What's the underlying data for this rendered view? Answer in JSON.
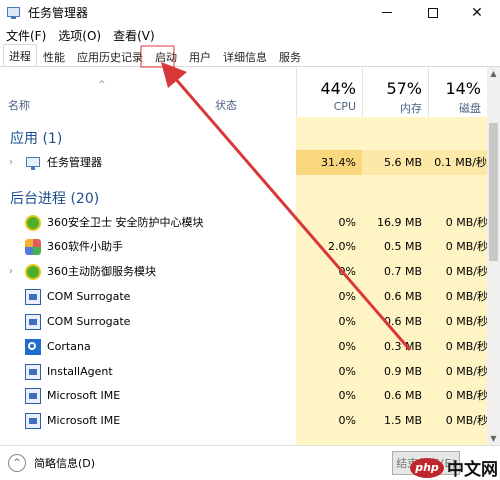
{
  "window": {
    "title": "任务管理器",
    "icon": "task-manager-icon",
    "controls": {
      "minimize": "minimize-icon",
      "maximize": "maximize-icon",
      "close": "close-icon",
      "close_glyph": "✕"
    }
  },
  "menu": {
    "items": [
      "文件(F)",
      "选项(O)",
      "查看(V)"
    ]
  },
  "tabs": [
    {
      "label": "进程",
      "active": true
    },
    {
      "label": "性能",
      "active": false
    },
    {
      "label": "应用历史记录",
      "active": false
    },
    {
      "label": "启动",
      "active": false,
      "highlighted": true
    },
    {
      "label": "用户",
      "active": false
    },
    {
      "label": "详细信息",
      "active": false
    },
    {
      "label": "服务",
      "active": false
    }
  ],
  "header": {
    "sort_glyph": "^",
    "name": "名称",
    "status": "状态",
    "cpu": {
      "percent": "44%",
      "label": "CPU"
    },
    "memory": {
      "percent": "57%",
      "label": "内存"
    },
    "disk": {
      "percent": "14%",
      "label": "磁盘"
    }
  },
  "sections": {
    "apps": "应用 (1)",
    "background": "后台进程 (20)"
  },
  "apps": [
    {
      "expander": "›",
      "icon": "task-manager-icon",
      "name": "任务管理器",
      "cpu": "31.4%",
      "memory": "5.6 MB",
      "disk": "0.1 MB/秒"
    }
  ],
  "background": [
    {
      "expander": "",
      "icon": "360-icon",
      "name": "360安全卫士 安全防护中心模块",
      "cpu": "0%",
      "memory": "16.9 MB",
      "disk": "0 MB/秒"
    },
    {
      "expander": "",
      "icon": "software-assistant-icon",
      "name": "360软件小助手",
      "cpu": "2.0%",
      "memory": "0.5 MB",
      "disk": "0 MB/秒"
    },
    {
      "expander": "›",
      "icon": "360-icon",
      "name": "360主动防御服务模块",
      "cpu": "0%",
      "memory": "0.7 MB",
      "disk": "0 MB/秒"
    },
    {
      "expander": "",
      "icon": "window-app-icon",
      "name": "COM Surrogate",
      "cpu": "0%",
      "memory": "0.6 MB",
      "disk": "0 MB/秒"
    },
    {
      "expander": "",
      "icon": "window-app-icon",
      "name": "COM Surrogate",
      "cpu": "0%",
      "memory": "0.6 MB",
      "disk": "0 MB/秒"
    },
    {
      "expander": "",
      "icon": "cortana-icon",
      "name": "Cortana",
      "cpu": "0%",
      "memory": "0.3 MB",
      "disk": "0 MB/秒"
    },
    {
      "expander": "",
      "icon": "window-app-icon",
      "name": "InstallAgent",
      "cpu": "0%",
      "memory": "0.9 MB",
      "disk": "0 MB/秒"
    },
    {
      "expander": "",
      "icon": "window-app-icon",
      "name": "Microsoft IME",
      "cpu": "0%",
      "memory": "0.6 MB",
      "disk": "0 MB/秒"
    },
    {
      "expander": "",
      "icon": "window-app-icon",
      "name": "Microsoft IME",
      "cpu": "0%",
      "memory": "1.5 MB",
      "disk": "0 MB/秒"
    }
  ],
  "scrollbar": {
    "up": "▲",
    "down": "▼"
  },
  "footer": {
    "toggle": "^",
    "fewer_details": "简略信息(D)",
    "end_task": "结束任务(E)"
  },
  "watermark": {
    "badge": "php",
    "text": "中文网"
  },
  "annotation": {
    "color": "#d9383a",
    "points_to": "启动"
  }
}
